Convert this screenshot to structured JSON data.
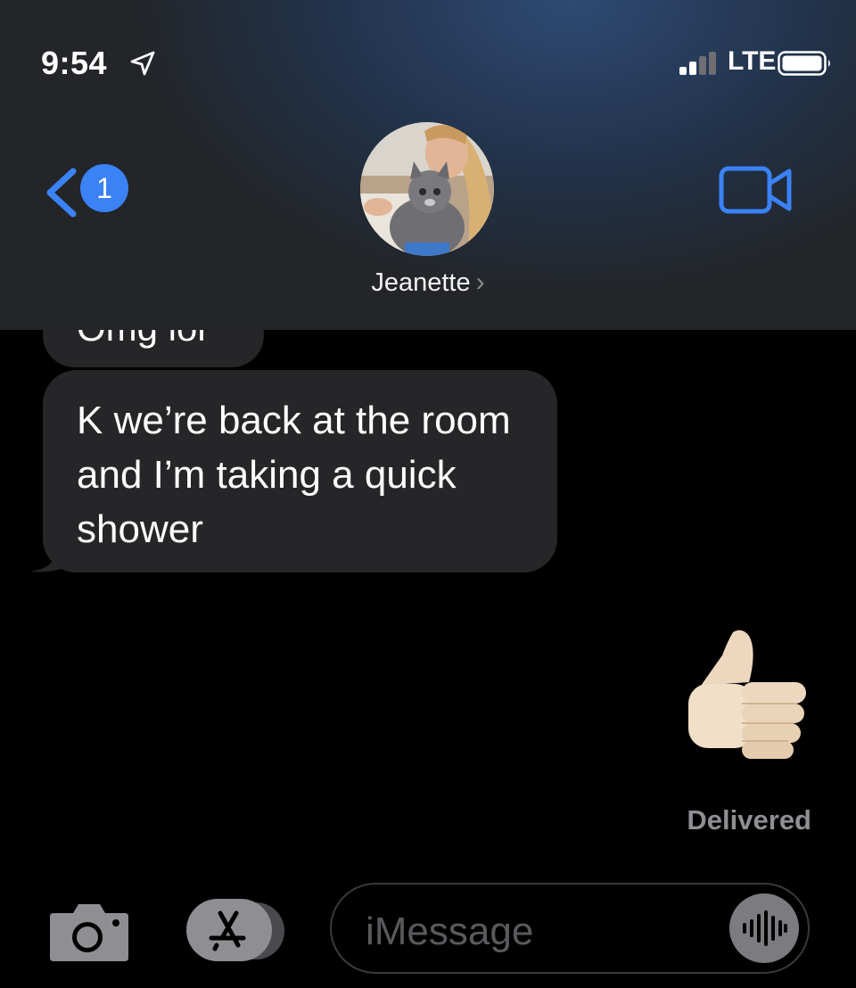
{
  "status_bar": {
    "time": "9:54",
    "network": "LTE",
    "location_icon": "location-arrow-icon",
    "signal_icon": "signal-bars-icon",
    "battery_icon": "battery-icon"
  },
  "header": {
    "back_badge_count": "1",
    "contact_name": "Jeanette",
    "contact_chevron": "›",
    "back_icon": "chevron-left-icon",
    "video_icon": "video-camera-icon",
    "accent_color": "#3b82f6"
  },
  "messages": {
    "partial_message": "Omg lol",
    "incoming_message": "K we’re back at the room and I’m taking a quick shower",
    "outgoing_emoji": "👍",
    "status": "Delivered"
  },
  "composer": {
    "placeholder": "iMessage",
    "camera_icon": "camera-icon",
    "apps_icon": "app-store-icon",
    "audio_icon": "audio-waveform-icon"
  }
}
